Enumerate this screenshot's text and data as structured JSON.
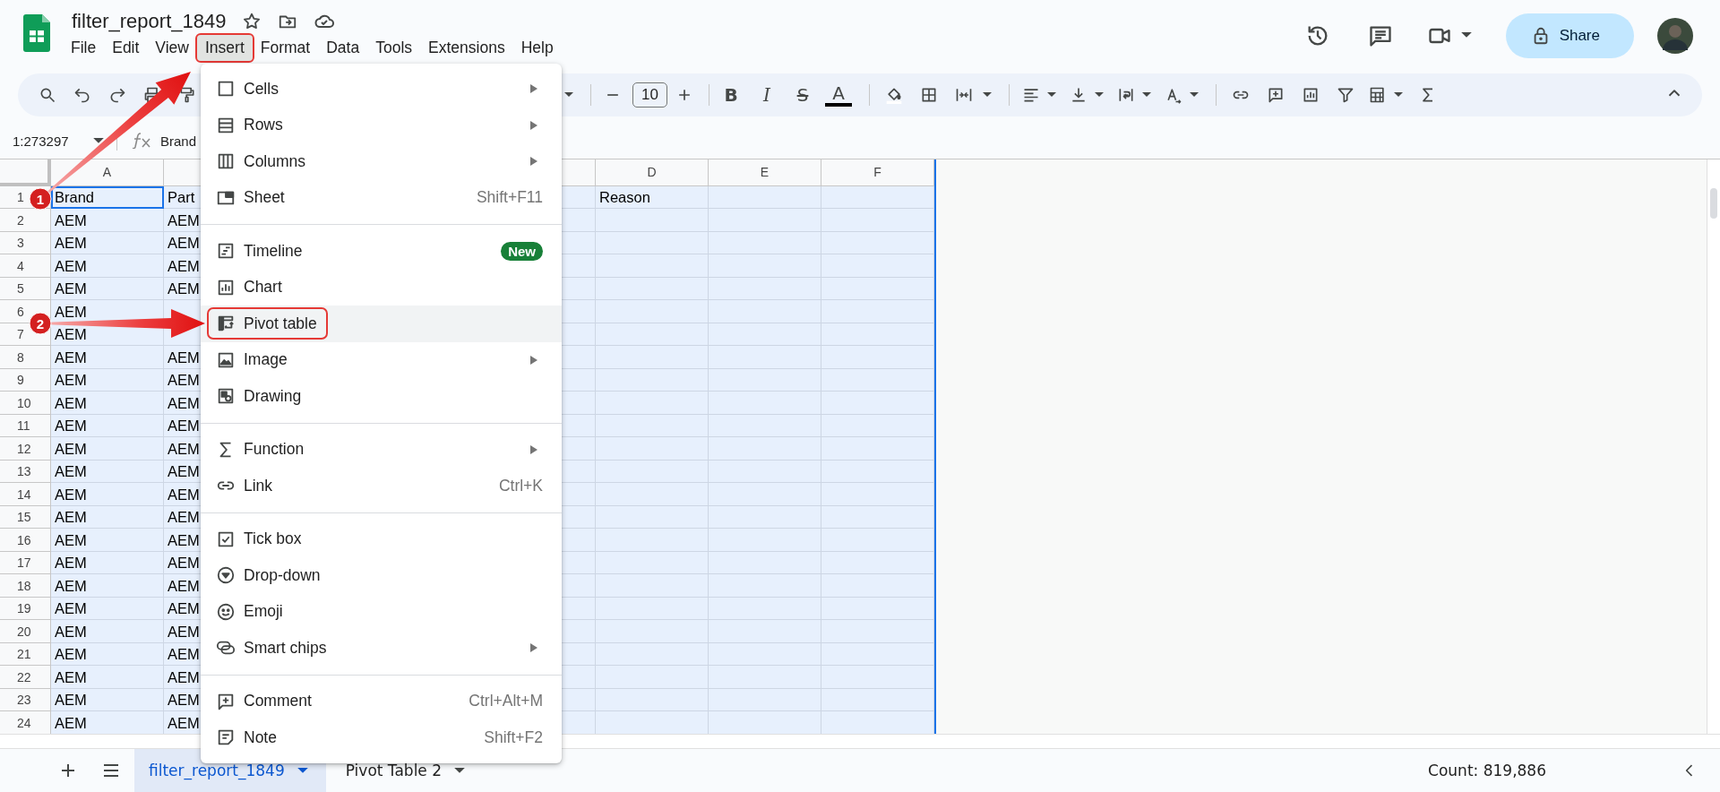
{
  "document": {
    "title": "filter_report_1849"
  },
  "menu_bar": [
    {
      "label": "File",
      "selected": false,
      "annotated": false
    },
    {
      "label": "Edit",
      "selected": false,
      "annotated": false
    },
    {
      "label": "View",
      "selected": false,
      "annotated": false
    },
    {
      "label": "Insert",
      "selected": true,
      "annotated": true
    },
    {
      "label": "Format",
      "selected": false,
      "annotated": false
    },
    {
      "label": "Data",
      "selected": false,
      "annotated": false
    },
    {
      "label": "Tools",
      "selected": false,
      "annotated": false
    },
    {
      "label": "Extensions",
      "selected": false,
      "annotated": false
    },
    {
      "label": "Help",
      "selected": false,
      "annotated": false
    }
  ],
  "share_button": {
    "label": "Share"
  },
  "toolbar": {
    "font_size": "10",
    "text_style_buttons": [
      {
        "label": "B"
      },
      {
        "label": "I"
      },
      {
        "label": "S"
      },
      {
        "label": "A"
      }
    ]
  },
  "name_box": {
    "value": "1:273297"
  },
  "formula_bar": {
    "value": "Brand"
  },
  "columns": [
    {
      "label": "A"
    },
    {},
    {},
    {
      "label": "D"
    },
    {
      "label": "E"
    },
    {
      "label": "F"
    }
  ],
  "rows": [
    {
      "number": "1",
      "column_a": "Brand",
      "column_b": "Part",
      "column_d": "Reason",
      "selected": true,
      "active": true
    },
    {
      "number": "2",
      "column_a": "AEM",
      "column_b": "AEM",
      "selected": true,
      "active": false
    },
    {
      "number": "3",
      "column_a": "AEM",
      "column_b": "AEM",
      "selected": true,
      "active": false
    },
    {
      "number": "4",
      "column_a": "AEM",
      "column_b": "AEM",
      "selected": true,
      "active": false
    },
    {
      "number": "5",
      "column_a": "AEM",
      "column_b": "AEM",
      "selected": true,
      "active": false
    },
    {
      "number": "6",
      "column_a": "AEM",
      "selected": true,
      "active": false
    },
    {
      "number": "7",
      "column_a": "AEM",
      "selected": true,
      "active": false
    },
    {
      "number": "8",
      "column_a": "AEM",
      "column_b": "AEM",
      "selected": true,
      "active": false
    },
    {
      "number": "9",
      "column_a": "AEM",
      "column_b": "AEM",
      "selected": true,
      "active": false
    },
    {
      "number": "10",
      "column_a": "AEM",
      "column_b": "AEM",
      "selected": true,
      "active": false
    },
    {
      "number": "11",
      "column_a": "AEM",
      "column_b": "AEM",
      "selected": true,
      "active": false
    },
    {
      "number": "12",
      "column_a": "AEM",
      "column_b": "AEM",
      "selected": true,
      "active": false
    },
    {
      "number": "13",
      "column_a": "AEM",
      "column_b": "AEM",
      "selected": true,
      "active": false
    },
    {
      "number": "14",
      "column_a": "AEM",
      "column_b": "AEM",
      "selected": true,
      "active": false
    },
    {
      "number": "15",
      "column_a": "AEM",
      "column_b": "AEM",
      "selected": true,
      "active": false
    },
    {
      "number": "16",
      "column_a": "AEM",
      "column_b": "AEM",
      "selected": true,
      "active": false
    },
    {
      "number": "17",
      "column_a": "AEM",
      "column_b": "AEM",
      "selected": true,
      "active": false
    },
    {
      "number": "18",
      "column_a": "AEM",
      "column_b": "AEM",
      "selected": true,
      "active": false
    },
    {
      "number": "19",
      "column_a": "AEM",
      "column_b": "AEM",
      "selected": true,
      "active": false
    },
    {
      "number": "20",
      "column_a": "AEM",
      "column_b": "AEM",
      "selected": true,
      "active": false
    },
    {
      "number": "21",
      "column_a": "AEM",
      "column_b": "AEM",
      "selected": true,
      "active": false
    },
    {
      "number": "22",
      "column_a": "AEM",
      "column_b": "AEM",
      "selected": true,
      "active": false
    },
    {
      "number": "23",
      "column_a": "AEM",
      "column_b": "AEM",
      "selected": true,
      "active": false
    },
    {
      "number": "24",
      "column_a": "AEM",
      "column_b": "AEM",
      "selected": true,
      "active": false
    }
  ],
  "insert_menu": {
    "sections": [
      {
        "items": [
          {
            "label": "Cells",
            "submenu": true,
            "highlighted": false,
            "annotated": false
          },
          {
            "label": "Rows",
            "submenu": true,
            "highlighted": false,
            "annotated": false
          },
          {
            "label": "Columns",
            "submenu": true,
            "highlighted": false,
            "annotated": false
          },
          {
            "label": "Sheet",
            "shortcut": "Shift+F11",
            "submenu": false,
            "highlighted": false,
            "annotated": false
          }
        ]
      },
      {
        "items": [
          {
            "label": "Timeline",
            "badge": "New",
            "submenu": false,
            "highlighted": false,
            "annotated": false
          },
          {
            "label": "Chart",
            "submenu": false,
            "highlighted": false,
            "annotated": false
          },
          {
            "label": "Pivot table",
            "submenu": false,
            "highlighted": true,
            "annotated": true
          },
          {
            "label": "Image",
            "submenu": true,
            "highlighted": false,
            "annotated": false
          },
          {
            "label": "Drawing",
            "submenu": false,
            "highlighted": false,
            "annotated": false
          }
        ]
      },
      {
        "items": [
          {
            "label": "Function",
            "submenu": true,
            "highlighted": false,
            "annotated": false
          },
          {
            "label": "Link",
            "shortcut": "Ctrl+K",
            "submenu": false,
            "highlighted": false,
            "annotated": false
          }
        ]
      },
      {
        "items": [
          {
            "label": "Tick box",
            "submenu": false,
            "highlighted": false,
            "annotated": false
          },
          {
            "label": "Drop-down",
            "submenu": false,
            "highlighted": false,
            "annotated": false
          },
          {
            "label": "Emoji",
            "submenu": false,
            "highlighted": false,
            "annotated": false
          },
          {
            "label": "Smart chips",
            "submenu": true,
            "highlighted": false,
            "annotated": false
          }
        ]
      },
      {
        "items": [
          {
            "label": "Comment",
            "shortcut": "Ctrl+Alt+M",
            "submenu": false,
            "highlighted": false,
            "annotated": false
          },
          {
            "label": "Note",
            "shortcut": "Shift+F2",
            "submenu": false,
            "highlighted": false,
            "annotated": false
          }
        ]
      }
    ]
  },
  "sheet_tabs": [
    {
      "label": "filter_report_1849",
      "selected": true
    },
    {
      "label": "Pivot Table 2",
      "selected": false
    }
  ],
  "status_bar": {
    "count": "Count: 819,886"
  },
  "callouts": [
    {
      "number": "1"
    },
    {
      "number": "2"
    }
  ]
}
